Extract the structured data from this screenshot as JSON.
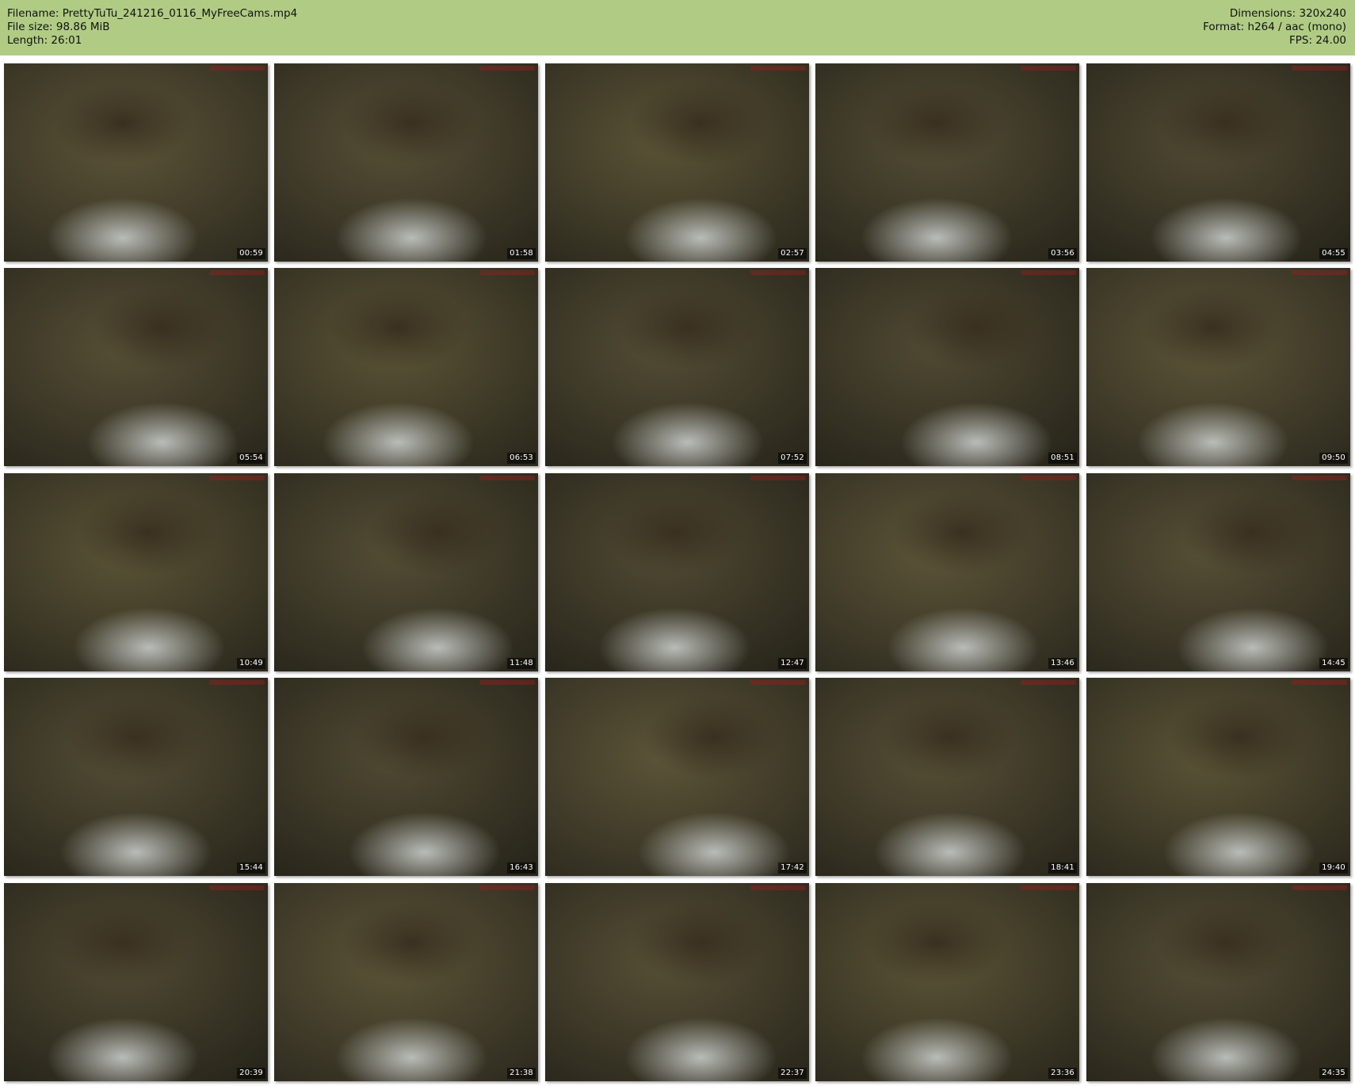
{
  "header": {
    "filename": "Filename: PrettyTuTu_241216_0116_MyFreeCams.mp4",
    "file_size": "File size: 98.86 MiB",
    "length": "Length: 26:01",
    "dimensions": "Dimensions: 320x240",
    "format": "Format: h264 / aac (mono)",
    "fps": "FPS: 24.00"
  },
  "colors": {
    "header_bg": "#b0cc84",
    "page_bg": "#ffffff"
  },
  "thumbnails": [
    {
      "time": "00:59"
    },
    {
      "time": "01:58"
    },
    {
      "time": "02:57"
    },
    {
      "time": "03:56"
    },
    {
      "time": "04:55"
    },
    {
      "time": "05:54"
    },
    {
      "time": "06:53"
    },
    {
      "time": "07:52"
    },
    {
      "time": "08:51"
    },
    {
      "time": "09:50"
    },
    {
      "time": "10:49"
    },
    {
      "time": "11:48"
    },
    {
      "time": "12:47"
    },
    {
      "time": "13:46"
    },
    {
      "time": "14:45"
    },
    {
      "time": "15:44"
    },
    {
      "time": "16:43"
    },
    {
      "time": "17:42"
    },
    {
      "time": "18:41"
    },
    {
      "time": "19:40"
    },
    {
      "time": "20:39"
    },
    {
      "time": "21:38"
    },
    {
      "time": "22:37"
    },
    {
      "time": "23:36"
    },
    {
      "time": "24:35"
    }
  ]
}
